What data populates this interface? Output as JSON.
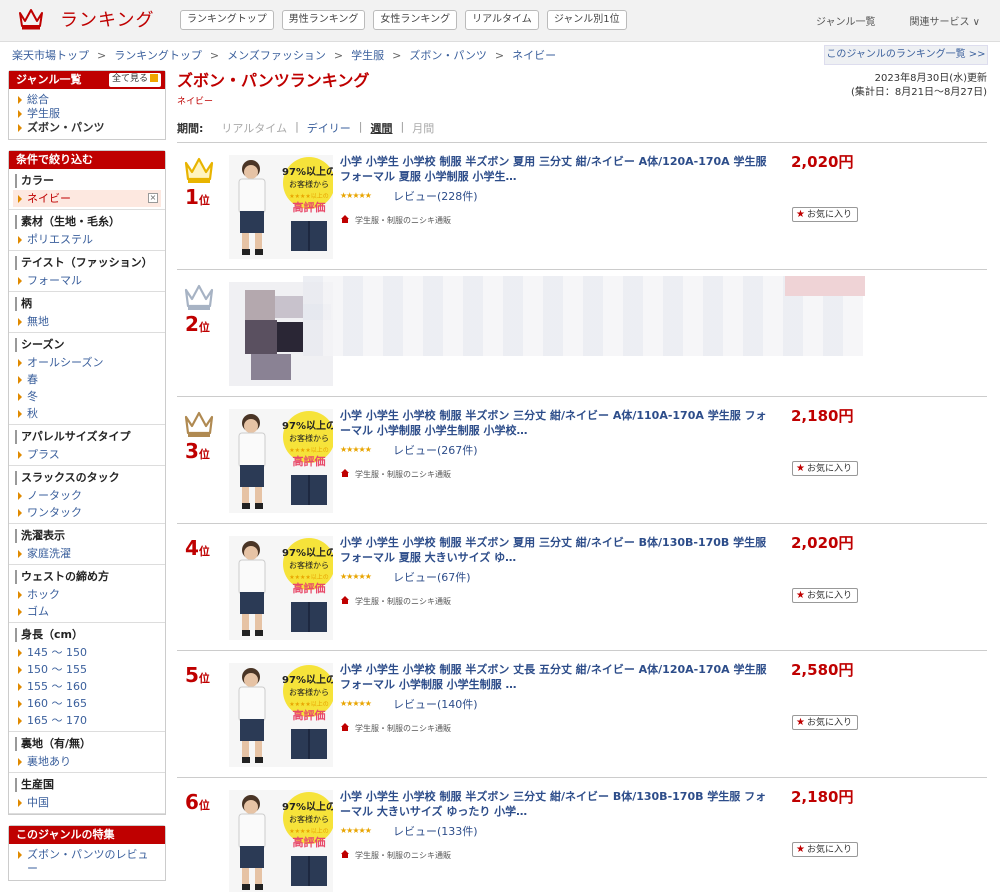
{
  "header": {
    "logo_text": "ランキング",
    "nav": [
      "ランキングトップ",
      "男性ランキング",
      "女性ランキング",
      "リアルタイム",
      "ジャンル別1位"
    ],
    "right_links": [
      "ジャンル一覧",
      "関連サービス ∨"
    ]
  },
  "breadcrumb": [
    "楽天市場トップ",
    "ランキングトップ",
    "メンズファッション",
    "学生服",
    "ズボン・パンツ",
    "ネイビー"
  ],
  "genre_ranking_link": "このジャンルのランキング一覧 >>",
  "sidebar": {
    "genre_box": {
      "title": "ジャンル一覧",
      "see_all": "全て見る",
      "items": [
        "総合",
        "学生服",
        "ズボン・パンツ"
      ]
    },
    "filter_box": {
      "title": "条件で絞り込む",
      "groups": [
        {
          "title": "カラー",
          "items": [
            "ネイビー"
          ]
        },
        {
          "title": "素材（生地・毛糸）",
          "items": [
            "ポリエステル"
          ]
        },
        {
          "title": "テイスト（ファッション）",
          "items": [
            "フォーマル"
          ]
        },
        {
          "title": "柄",
          "items": [
            "無地"
          ]
        },
        {
          "title": "シーズン",
          "items": [
            "オールシーズン",
            "春",
            "冬",
            "秋"
          ]
        },
        {
          "title": "アパレルサイズタイプ",
          "items": [
            "プラス"
          ]
        },
        {
          "title": "スラックスのタック",
          "items": [
            "ノータック",
            "ワンタック"
          ]
        },
        {
          "title": "洗濯表示",
          "items": [
            "家庭洗濯"
          ]
        },
        {
          "title": "ウェストの締め方",
          "items": [
            "ホック",
            "ゴム"
          ]
        },
        {
          "title": "身長（cm）",
          "items": [
            "145 ～ 150",
            "150 ～ 155",
            "155 ～ 160",
            "160 ～ 165",
            "165 ～ 170"
          ]
        },
        {
          "title": "裏地（有/無）",
          "items": [
            "裏地あり"
          ]
        },
        {
          "title": "生産国",
          "items": [
            "中国"
          ]
        }
      ]
    },
    "feature_box": {
      "title": "このジャンルの特集",
      "items": [
        "ズボン・パンツのレビュー"
      ]
    }
  },
  "main": {
    "title": "ズボン・パンツランキング",
    "subgenre": "ネイビー",
    "updated": "2023年8月30日(水)更新",
    "period_range": "(集計日：8月21日～8月27日)",
    "period_label": "期間:",
    "period_options": [
      "リアルタイム",
      "デイリー",
      "週間",
      "月間"
    ],
    "items": [
      {
        "rank": "1",
        "rank_suffix": "位",
        "title": "小学 小学生 小学校 制服 半ズボン 夏用 三分丈 紺/ネイビー A体/120A-170A 学生服 フォーマル 夏服 小学制服 小学生…",
        "price": "2,020円",
        "review": "レビュー(228件)",
        "shop": "学生服・制服のニシキ通販",
        "fav": "お気に入り",
        "crown": "gold",
        "rating": 4.5
      },
      {
        "rank": "2",
        "rank_suffix": "位",
        "title": "",
        "price": "",
        "review": "",
        "shop": "",
        "fav": "",
        "crown": "silver",
        "rating": 0
      },
      {
        "rank": "3",
        "rank_suffix": "位",
        "title": "小学 小学生 小学校 制服 半ズボン 三分丈 紺/ネイビー A体/110A-170A 学生服 フォーマル 小学制服 小学生制服 小学校…",
        "price": "2,180円",
        "review": "レビュー(267件)",
        "shop": "学生服・制服のニシキ通販",
        "fav": "お気に入り",
        "crown": "bronze",
        "rating": 4.5
      },
      {
        "rank": "4",
        "rank_suffix": "位",
        "title": "小学 小学生 小学校 制服 半ズボン 夏用 三分丈 紺/ネイビー B体/130B-170B 学生服 フォーマル 夏服 大きいサイズ ゆ…",
        "price": "2,020円",
        "review": "レビュー(67件)",
        "shop": "学生服・制服のニシキ通販",
        "fav": "お気に入り",
        "crown": "",
        "rating": 4.5
      },
      {
        "rank": "5",
        "rank_suffix": "位",
        "title": "小学 小学生 小学校 制服 半ズボン 丈長 五分丈 紺/ネイビー A体/120A-170A 学生服 フォーマル 小学制服 小学生制服 …",
        "price": "2,580円",
        "review": "レビュー(140件)",
        "shop": "学生服・制服のニシキ通販",
        "fav": "お気に入り",
        "crown": "",
        "rating": 4.5
      },
      {
        "rank": "6",
        "rank_suffix": "位",
        "title": "小学 小学生 小学校 制服 半ズボン 三分丈 紺/ネイビー B体/130B-170B 学生服 フォーマル 大きいサイズ ゆったり 小学…",
        "price": "2,180円",
        "review": "レビュー(133件)",
        "shop": "学生服・制服のニシキ通販",
        "fav": "お気に入り",
        "crown": "",
        "rating": 4.5
      }
    ],
    "thumb_badge": {
      "top": "97%以上の",
      "mid": "お客様から",
      "small": "★★★★以上の",
      "big": "高評価"
    }
  },
  "colors": {
    "accent": "#bf0000",
    "link": "#2d4d8a",
    "gold": "#e8b400",
    "silver": "#a7b3c4",
    "bronze": "#b08a52"
  }
}
